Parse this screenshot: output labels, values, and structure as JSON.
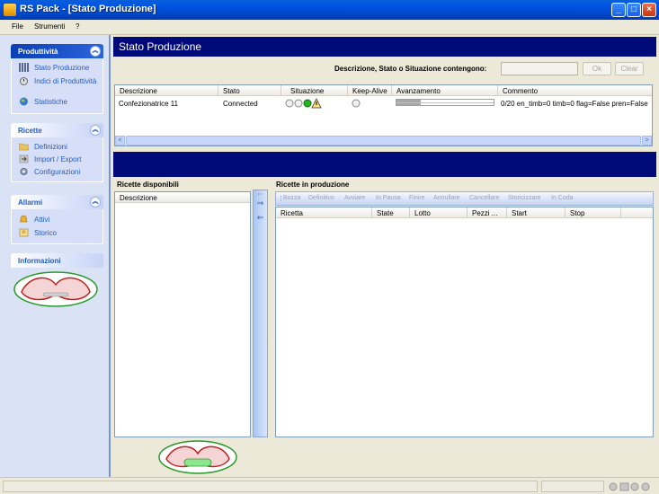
{
  "window": {
    "title": "RS Pack - [Stato Produzione]",
    "minimize": "_",
    "maximize": "□",
    "close": "×"
  },
  "menu": {
    "file": "File",
    "tools": "Strumenti",
    "help": "?"
  },
  "sidebar": {
    "productivity": {
      "title": "Produttività",
      "items": [
        {
          "label": "Stato Produzione",
          "icon": "bars-icon"
        },
        {
          "label": "Indici di Produttività",
          "icon": "stopwatch-icon"
        },
        {
          "label": "Statistiche",
          "icon": "globe-icon"
        }
      ]
    },
    "recipes": {
      "title": "Ricette",
      "items": [
        {
          "label": "Definizioni",
          "icon": "folder-open-icon"
        },
        {
          "label": "Import / Export",
          "icon": "import-export-icon"
        },
        {
          "label": "Configurazioni",
          "icon": "gear-icon"
        }
      ]
    },
    "alarms": {
      "title": "Allarmi",
      "items": [
        {
          "label": "Attivi",
          "icon": "alarm-active-icon"
        },
        {
          "label": "Storico",
          "icon": "alarm-history-icon"
        }
      ]
    },
    "info": {
      "title": "Informazioni"
    }
  },
  "main": {
    "title": "Stato Produzione",
    "search": {
      "label": "Descrizione, Stato o Situazione contengono:",
      "value": "",
      "ok": "Ok",
      "clear": "Clear"
    },
    "machines": {
      "columns": [
        "Descrizione",
        "Stato",
        "Situazione",
        "Keep-Alive",
        "Avanzamento",
        "Commento"
      ],
      "rows": [
        {
          "descrizione": "Confezionatrice 11",
          "stato": "Connected",
          "commento": "0/20 en_timb=0 timb=0 flag=False pren=False"
        }
      ]
    },
    "available_recipes": {
      "title": "Ricette disponibili",
      "columns": [
        "Descrizione"
      ]
    },
    "production_recipes": {
      "title": "Ricette in produzione",
      "toolbar": [
        "Bozza",
        "Definitivo",
        "Avviare",
        "In Pausa",
        "Finire",
        "Annullare",
        "Cancellare",
        "Storicizzare",
        "In Coda"
      ],
      "columns": [
        "Ricetta",
        "State",
        "Lotto",
        "Pezzi ...",
        "Start",
        "Stop"
      ]
    }
  },
  "colors": {
    "header_navy": "#000a78",
    "sidebar": "#dae3f5",
    "link": "#215dc6",
    "status_green": "#22b422"
  }
}
